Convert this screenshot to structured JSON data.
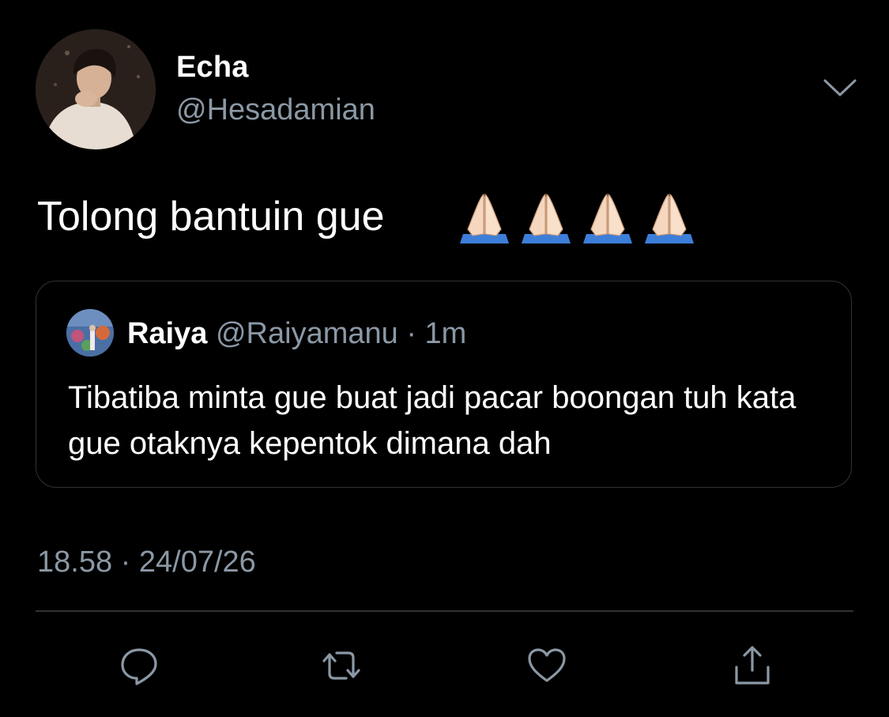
{
  "tweet": {
    "author": {
      "display_name": "Echa",
      "handle": "@Hesadamian",
      "avatar_icon": "profile-photo"
    },
    "text": "Tolong bantuin gue",
    "emoji": [
      "folded-hands-icon",
      "folded-hands-icon",
      "folded-hands-icon",
      "folded-hands-icon"
    ],
    "timestamp": "18.58 · 24/07/26"
  },
  "quote": {
    "display_name": "Raiya",
    "handle": "@Raiyamanu",
    "separator": "·",
    "time": "1m",
    "text": "Tibatiba minta gue buat jadi pacar boongan tuh kata gue otaknya kepentok dimana dah"
  },
  "actions": [
    "reply-icon",
    "retweet-icon",
    "like-icon",
    "share-icon"
  ],
  "colors": {
    "background": "#000000",
    "text_primary": "#ffffff",
    "text_secondary": "#8b98a5",
    "border": "#2f3336"
  }
}
